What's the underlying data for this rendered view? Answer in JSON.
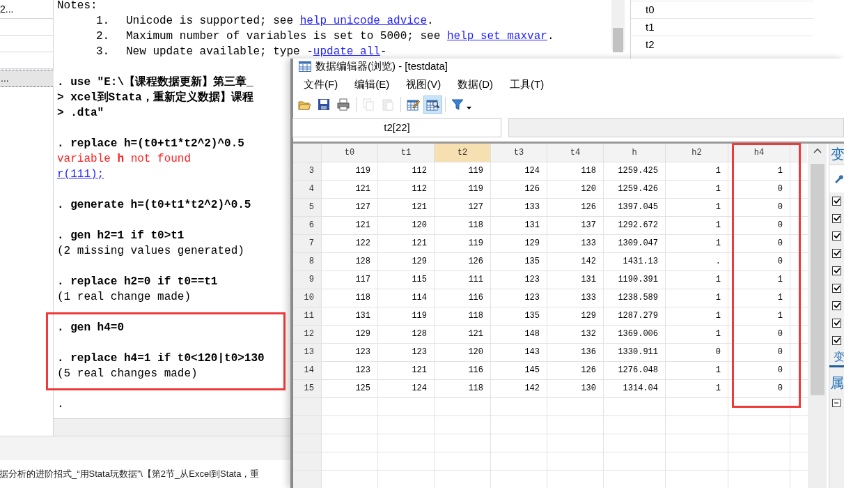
{
  "left_panel": {
    "items": [
      {
        "label": "2...",
        "selected": false
      },
      {
        "label": "...",
        "selected": true
      }
    ]
  },
  "results": {
    "lines": [
      {
        "kind": "output",
        "text": "Notes:"
      },
      {
        "kind": "note",
        "number": "1.",
        "text": "Unicode is supported; see ",
        "link": "help unicode advice",
        "after": "."
      },
      {
        "kind": "note",
        "number": "2.",
        "text": "Maximum number of variables is set to 5000; see ",
        "link": "help set maxvar",
        "after": "."
      },
      {
        "kind": "note",
        "number": "3.",
        "text": "New update available; type -",
        "link": "update all",
        "after": "-"
      },
      {
        "kind": "blank"
      },
      {
        "kind": "command",
        "text": ". use \"E:\\【课程数据更新】第三章_"
      },
      {
        "kind": "command",
        "text": "> xcel到Stata，重新定义数据】课程"
      },
      {
        "kind": "command",
        "text": "> .dta\""
      },
      {
        "kind": "blank"
      },
      {
        "kind": "command",
        "text": ". replace h=(t0+t1*t2^2)^0.5"
      },
      {
        "kind": "error",
        "text": "variable **h** not found"
      },
      {
        "kind": "return_code",
        "text": "r(111);"
      },
      {
        "kind": "blank"
      },
      {
        "kind": "command",
        "text": ". generate h=(t0+t1*t2^2)^0.5"
      },
      {
        "kind": "blank"
      },
      {
        "kind": "command",
        "text": ". gen h2=1 if t0>t1"
      },
      {
        "kind": "output",
        "text": "(2 missing values generated)"
      },
      {
        "kind": "blank"
      },
      {
        "kind": "command",
        "text": ". replace h2=0 if t0==t1"
      },
      {
        "kind": "output",
        "text": "(1 real change made)"
      },
      {
        "kind": "blank"
      },
      {
        "kind": "command",
        "text": ". gen h4=0"
      },
      {
        "kind": "blank"
      },
      {
        "kind": "command",
        "text": ". replace h4=1 if t0<120|t0>130"
      },
      {
        "kind": "output",
        "text": "(5 real changes made)"
      },
      {
        "kind": "blank"
      },
      {
        "kind": "output",
        "text": "."
      }
    ]
  },
  "variables_panel": {
    "items": [
      "t0",
      "t1",
      "t2"
    ]
  },
  "status_bar": {
    "text": "据分析的进阶招式_“用Stata玩数据”\\【第2节_从Excel到Stata，重"
  },
  "data_editor": {
    "title": "数据编辑器(浏览) - [testdata]",
    "menu": [
      "文件(F)",
      "编辑(E)",
      "视图(V)",
      "数据(D)",
      "工具(T)"
    ],
    "toolbar": [
      {
        "kind": "open",
        "selected": false,
        "disabled": false
      },
      {
        "kind": "save",
        "selected": false,
        "disabled": false
      },
      {
        "kind": "print",
        "selected": false,
        "disabled": false
      },
      {
        "kind": "separator"
      },
      {
        "kind": "copy",
        "selected": false,
        "disabled": true
      },
      {
        "kind": "paste",
        "selected": false,
        "disabled": true
      },
      {
        "kind": "separator"
      },
      {
        "kind": "edit",
        "selected": false,
        "disabled": false
      },
      {
        "kind": "browse",
        "selected": true,
        "disabled": false
      },
      {
        "kind": "separator"
      },
      {
        "kind": "filter",
        "selected": false,
        "disabled": false
      }
    ],
    "cell_name": "t2[22]",
    "columns": [
      {
        "name": "t0",
        "selected": false
      },
      {
        "name": "t1",
        "selected": false
      },
      {
        "name": "t2",
        "selected": true
      },
      {
        "name": "t3",
        "selected": false
      },
      {
        "name": "t4",
        "selected": false
      },
      {
        "name": "h",
        "selected": false
      },
      {
        "name": "h2",
        "selected": false
      },
      {
        "name": "h4",
        "selected": false
      }
    ],
    "rows": [
      {
        "number": "3",
        "cells": [
          "119",
          "112",
          "119",
          "124",
          "118",
          "1259.425",
          "1",
          "1"
        ]
      },
      {
        "number": "4",
        "cells": [
          "121",
          "112",
          "119",
          "126",
          "120",
          "1259.426",
          "1",
          "0"
        ]
      },
      {
        "number": "5",
        "cells": [
          "127",
          "121",
          "127",
          "133",
          "126",
          "1397.045",
          "1",
          "0"
        ]
      },
      {
        "number": "6",
        "cells": [
          "121",
          "120",
          "118",
          "131",
          "137",
          "1292.672",
          "1",
          "0"
        ]
      },
      {
        "number": "7",
        "cells": [
          "122",
          "121",
          "119",
          "129",
          "133",
          "1309.047",
          "1",
          "0"
        ]
      },
      {
        "number": "8",
        "cells": [
          "128",
          "129",
          "126",
          "135",
          "142",
          "1431.13",
          ".",
          "0"
        ]
      },
      {
        "number": "9",
        "cells": [
          "117",
          "115",
          "111",
          "123",
          "131",
          "1190.391",
          "1",
          "1"
        ]
      },
      {
        "number": "10",
        "cells": [
          "118",
          "114",
          "116",
          "123",
          "133",
          "1238.589",
          "1",
          "1"
        ]
      },
      {
        "number": "11",
        "cells": [
          "131",
          "119",
          "118",
          "135",
          "129",
          "1287.279",
          "1",
          "1"
        ]
      },
      {
        "number": "12",
        "cells": [
          "129",
          "128",
          "121",
          "148",
          "132",
          "1369.006",
          "1",
          "0"
        ]
      },
      {
        "number": "13",
        "cells": [
          "123",
          "123",
          "120",
          "143",
          "136",
          "1330.911",
          "0",
          "0"
        ]
      },
      {
        "number": "14",
        "cells": [
          "123",
          "121",
          "116",
          "145",
          "126",
          "1276.048",
          "1",
          "0"
        ]
      },
      {
        "number": "15",
        "cells": [
          "125",
          "124",
          "118",
          "142",
          "130",
          "1314.04",
          "1",
          "0"
        ]
      }
    ],
    "side_panel": {
      "titles": [
        "变",
        "属"
      ],
      "tab": {
        "label": "变",
        "selected": true
      },
      "checkboxes": [
        {
          "checked": true
        },
        {
          "checked": true
        },
        {
          "checked": true
        },
        {
          "checked": true
        },
        {
          "checked": true
        },
        {
          "checked": true
        },
        {
          "checked": true
        },
        {
          "checked": true
        },
        {
          "checked": true
        }
      ]
    }
  }
}
